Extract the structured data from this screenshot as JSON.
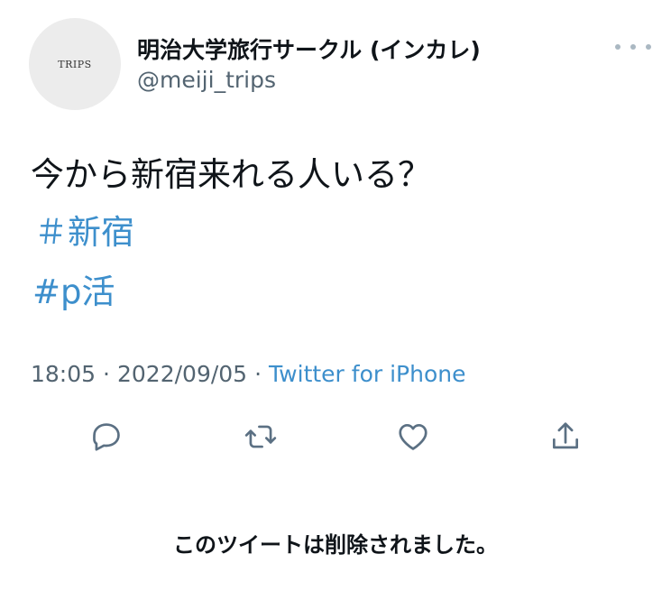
{
  "author": {
    "avatar_text": "TRIPS",
    "display_name": "明治大学旅行サークル (インカレ)",
    "handle": "@meiji_trips"
  },
  "tweet": {
    "text": "今から新宿来れる人いる？",
    "hashtags": [
      "＃新宿",
      "#p活"
    ],
    "time": "18:05",
    "separator": "·",
    "date": "2022/09/05",
    "source": "Twitter for iPhone"
  },
  "actions": {
    "icons": [
      "reply-icon",
      "retweet-icon",
      "like-icon",
      "share-icon"
    ]
  },
  "notice": "このツイートは削除されました。",
  "colors": {
    "link": "#3d8fcc",
    "secondary_text": "#536471",
    "icon": "#5b7083",
    "avatar_bg": "#ececec"
  }
}
